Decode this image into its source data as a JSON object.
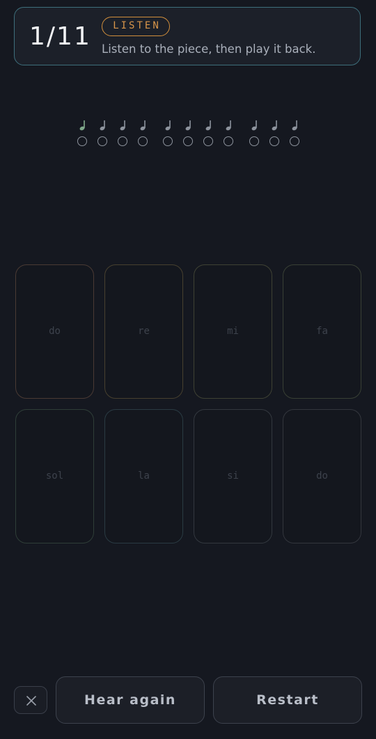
{
  "header": {
    "progress": "1/11",
    "mode_badge": "LISTEN",
    "instruction": "Listen to the piece, then play it back."
  },
  "sequence": {
    "groups": [
      {
        "notes": [
          {
            "state": "played"
          },
          {
            "state": "pending"
          },
          {
            "state": "pending"
          },
          {
            "state": "pending"
          }
        ]
      },
      {
        "notes": [
          {
            "state": "pending"
          },
          {
            "state": "pending"
          },
          {
            "state": "pending"
          },
          {
            "state": "pending"
          }
        ]
      },
      {
        "notes": [
          {
            "state": "pending"
          },
          {
            "state": "pending"
          },
          {
            "state": "pending"
          }
        ]
      }
    ],
    "colors": {
      "played": "#7fa88a",
      "pending": "#8d939d"
    }
  },
  "keypad": {
    "keys": [
      {
        "label": "do",
        "color": "#4a3a34"
      },
      {
        "label": "re",
        "color": "#47402f"
      },
      {
        "label": "mi",
        "color": "#3f4234"
      },
      {
        "label": "fa",
        "color": "#394035"
      },
      {
        "label": "sol",
        "color": "#2f3e38"
      },
      {
        "label": "la",
        "color": "#2a3b43"
      },
      {
        "label": "si",
        "color": "#33383f"
      },
      {
        "label": "do",
        "color": "#33363d"
      }
    ]
  },
  "footer": {
    "close_icon": "close-icon",
    "hear_again_label": "Hear again",
    "restart_label": "Restart"
  }
}
